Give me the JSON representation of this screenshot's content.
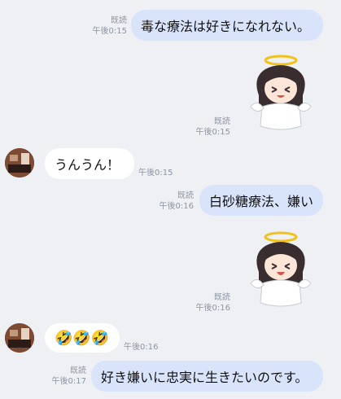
{
  "messages": [
    {
      "id": "m1",
      "side": "sent",
      "type": "text",
      "text": "毒な療法は好きになれない。",
      "read": "既読",
      "time": "午後0:15"
    },
    {
      "id": "m2",
      "side": "sent",
      "type": "sticker",
      "sticker": "angel-girl-sticker",
      "read": "既読",
      "time": "午後0:15"
    },
    {
      "id": "m3",
      "side": "recv",
      "type": "text",
      "text": "うんうん！",
      "time": "午後0:15"
    },
    {
      "id": "m4",
      "side": "sent",
      "type": "text",
      "text": "白砂糖療法、嫌い",
      "read": "既読",
      "time": "午後0:16"
    },
    {
      "id": "m5",
      "side": "sent",
      "type": "sticker",
      "sticker": "angel-girl-sticker",
      "read": "既読",
      "time": "午後0:16"
    },
    {
      "id": "m6",
      "side": "recv",
      "type": "emoji",
      "text": "🤣🤣🤣",
      "time": "午後0:16"
    },
    {
      "id": "m7",
      "side": "sent",
      "type": "text",
      "text": "好き嫌いに忠実に生きたいのです。",
      "read": "既読",
      "time": "午後0:17"
    }
  ],
  "colors": {
    "background": "#eef0f4",
    "sent_bubble": "#d9e4fb",
    "recv_bubble": "#ffffff",
    "meta": "#8f95a1"
  }
}
